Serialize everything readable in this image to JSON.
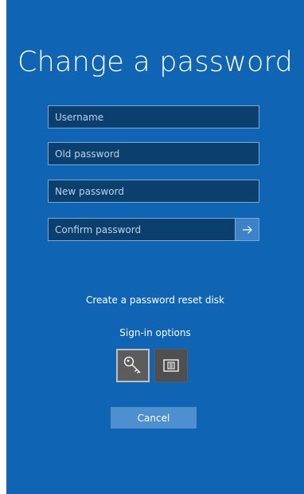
{
  "page": {
    "title": "Change a password"
  },
  "form": {
    "username_placeholder": "Username",
    "old_password_placeholder": "Old password",
    "new_password_placeholder": "New password",
    "confirm_password_placeholder": "Confirm password",
    "submit_icon": "arrow-right-icon"
  },
  "links": {
    "reset_disk": "Create a password reset disk",
    "signin_options": "Sign-in options"
  },
  "signin_options": [
    {
      "icon": "key-icon",
      "selected": true
    },
    {
      "icon": "smart-card-icon",
      "selected": false
    }
  ],
  "buttons": {
    "cancel": "Cancel"
  },
  "colors": {
    "background": "#0f65b3",
    "field_background": "#0b3f6e",
    "field_border": "#7aa9d6",
    "submit_button": "#3b82c6",
    "cancel_button": "#4d8fcf",
    "option_tile": "#5c5c5c"
  }
}
